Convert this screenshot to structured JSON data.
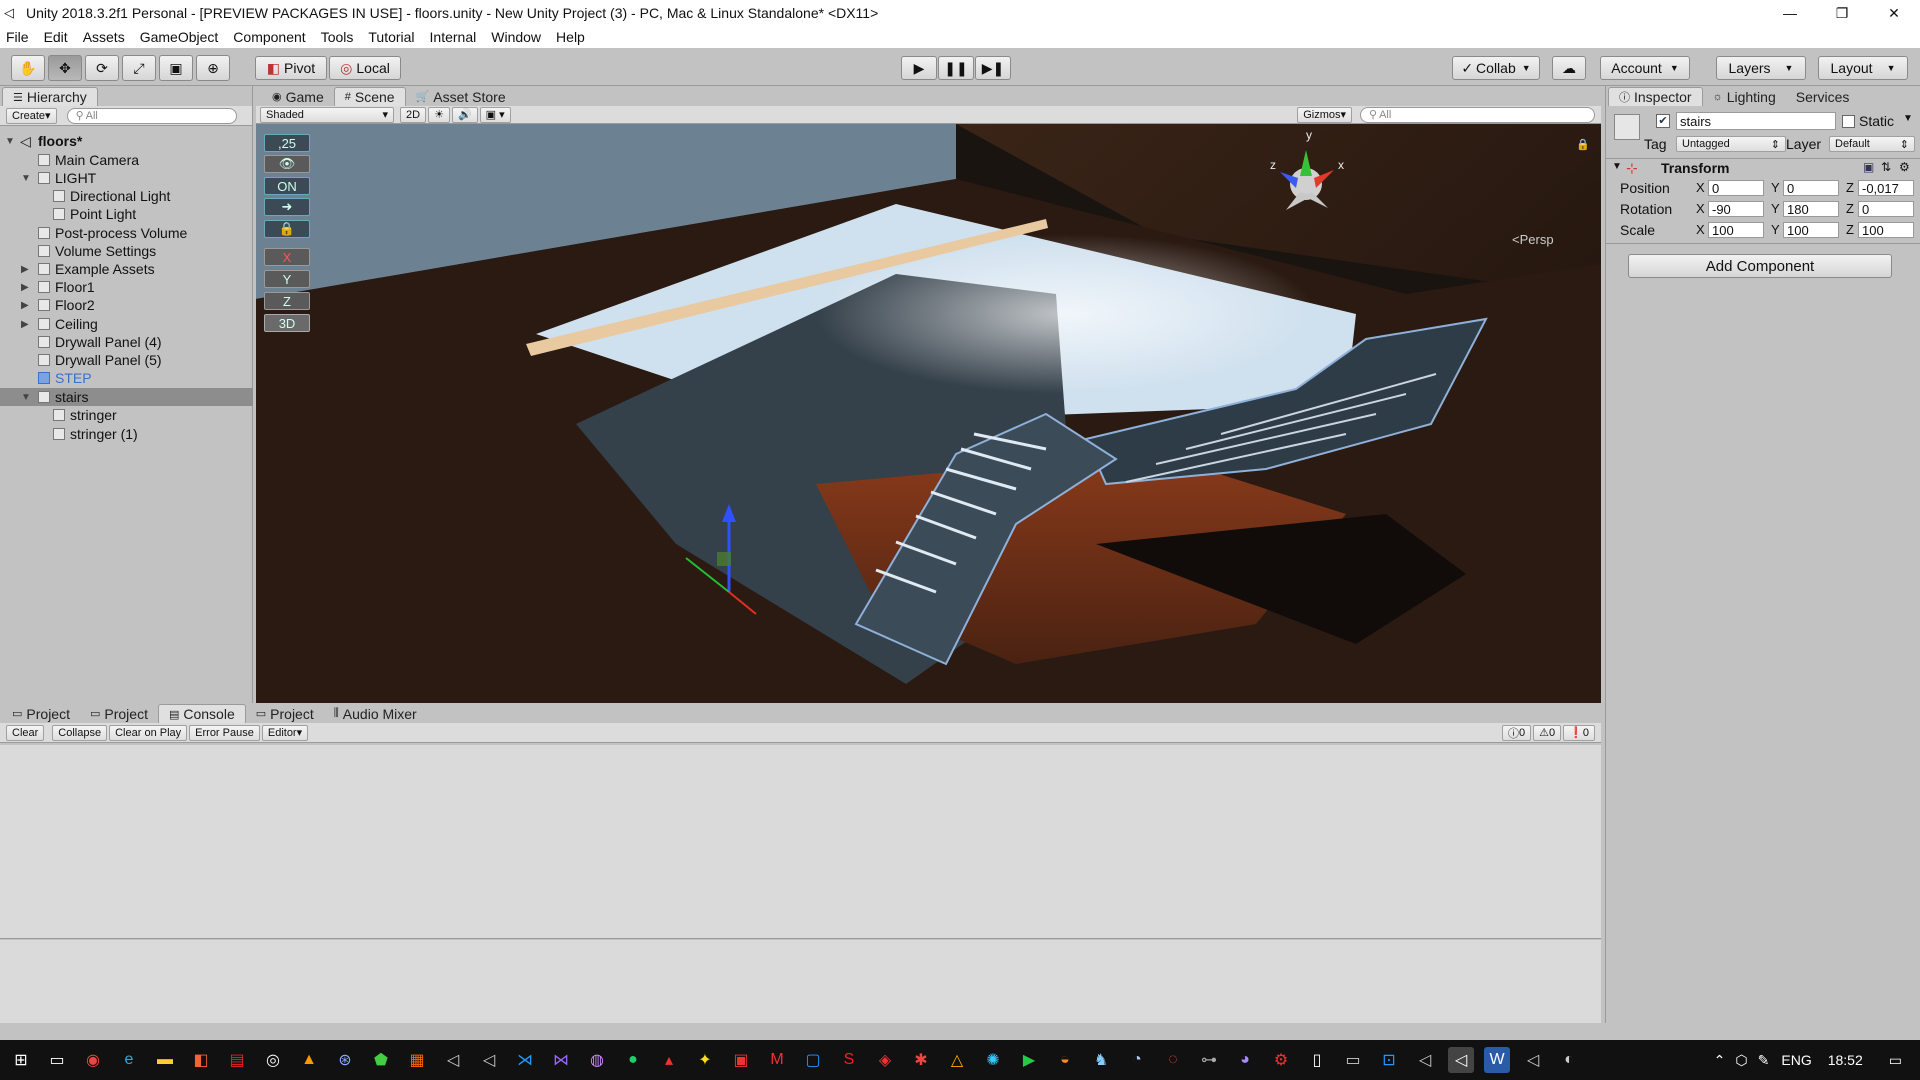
{
  "window": {
    "title": "Unity 2018.3.2f1 Personal - [PREVIEW PACKAGES IN USE] - floors.unity - New Unity Project (3) - PC, Mac & Linux Standalone* <DX11>",
    "controls": [
      "—",
      "❐",
      "✕"
    ]
  },
  "menu": [
    "File",
    "Edit",
    "Assets",
    "GameObject",
    "Component",
    "Tools",
    "Tutorial",
    "Internal",
    "Window",
    "Help"
  ],
  "toolbar": {
    "pivot": "Pivot",
    "local": "Local",
    "collab": "Collab",
    "account": "Account",
    "layers": "Layers",
    "layout": "Layout"
  },
  "hierarchy": {
    "tab": "Hierarchy",
    "create": "Create",
    "search": "All",
    "scene": "floors*",
    "items": [
      {
        "label": "Main Camera"
      },
      {
        "label": "LIGHT"
      },
      {
        "label": "Directional Light"
      },
      {
        "label": "Point Light"
      },
      {
        "label": "Post-process Volume"
      },
      {
        "label": "Volume Settings"
      },
      {
        "label": "Example Assets"
      },
      {
        "label": "Floor1"
      },
      {
        "label": "Floor2"
      },
      {
        "label": "Ceiling"
      },
      {
        "label": "Drywall Panel (4)"
      },
      {
        "label": "Drywall Panel (5)"
      },
      {
        "label": "STEP"
      },
      {
        "label": "stairs"
      },
      {
        "label": "stringer"
      },
      {
        "label": "stringer (1)"
      }
    ]
  },
  "scene": {
    "tabs": [
      "Game",
      "Scene",
      "Asset Store"
    ],
    "shading": "Shaded",
    "mode2d": "2D",
    "gizmos": "Gizmos",
    "search": "All",
    "persp": "Persp",
    "gizmo_labels": {
      "y": "y",
      "x": "x",
      "z": "z"
    },
    "snap_buttons": [
      ",25",
      "",
      "ON",
      "",
      "",
      "X",
      "Y",
      "Z",
      "3D"
    ]
  },
  "console": {
    "tabs": [
      "Project",
      "Project",
      "Console",
      "Project",
      "Audio Mixer"
    ],
    "buttons": [
      "Clear",
      "Collapse",
      "Clear on Play",
      "Error Pause",
      "Editor"
    ],
    "counts": [
      "0",
      "0",
      "0"
    ]
  },
  "inspector": {
    "tabs": [
      "Inspector",
      "Lighting",
      "Services"
    ],
    "name": "stairs",
    "static": "Static",
    "tag_label": "Tag",
    "tag": "Untagged",
    "layer_label": "Layer",
    "layer": "Default",
    "component": "Transform",
    "rows": [
      {
        "label": "Position",
        "x": "0",
        "y": "0",
        "z": "-0,017"
      },
      {
        "label": "Rotation",
        "x": "-90",
        "y": "180",
        "z": "0"
      },
      {
        "label": "Scale",
        "x": "100",
        "y": "100",
        "z": "100"
      }
    ],
    "add_component": "Add Component",
    "axis": {
      "x": "X",
      "y": "Y",
      "z": "Z"
    }
  },
  "taskbar": {
    "lang": "ENG",
    "time": "18:52"
  }
}
